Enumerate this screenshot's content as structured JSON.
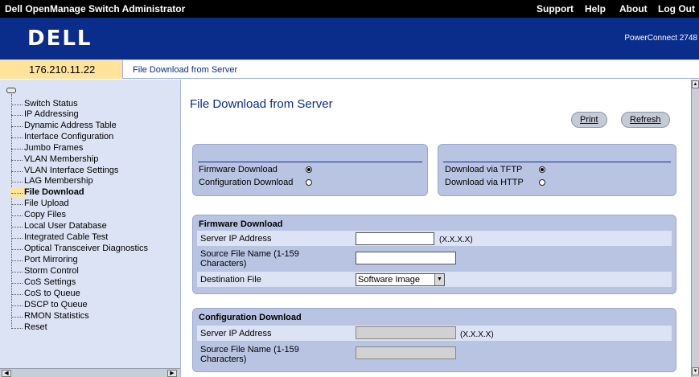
{
  "topbar": {
    "app_title": "Dell OpenManage Switch Administrator",
    "support": "Support",
    "help": "Help",
    "about": "About",
    "logout": "Log Out"
  },
  "banner": {
    "logo": "DELL",
    "product": "PowerConnect 2748"
  },
  "strip": {
    "ip": "176.210.11.22",
    "breadcrumb": "File Download from Server"
  },
  "tree": {
    "items": [
      "Switch Status",
      "IP Addressing",
      "Dynamic Address Table",
      "Interface Configuration",
      "Jumbo Frames",
      "VLAN Membership",
      "VLAN Interface Settings",
      "LAG Membership",
      "File Download",
      "File Upload",
      "Copy Files",
      "Local User Database",
      "Integrated Cable Test",
      "Optical Transceiver Diagnostics",
      "Port Mirroring",
      "Storm Control",
      "CoS Settings",
      "CoS to Queue",
      "DSCP to Queue",
      "RMON Statistics",
      "Reset"
    ],
    "active": "File Download"
  },
  "main": {
    "title": "File Download from Server",
    "print": "Print",
    "refresh": "Refresh",
    "type_panel": {
      "firmware": "Firmware Download",
      "configuration": "Configuration Download",
      "selected": "firmware"
    },
    "via_panel": {
      "tftp": "Download via TFTP",
      "http": "Download via HTTP",
      "selected": "tftp"
    },
    "firmware_section": {
      "heading": "Firmware Download",
      "server_ip_label": "Server IP Address",
      "server_ip_value": "",
      "ip_hint": "(X.X.X.X)",
      "source_label_1": "Source File Name (1-159",
      "source_label_2": "Characters)",
      "source_value": "",
      "dest_label": "Destination File",
      "dest_value": "Software Image"
    },
    "config_section": {
      "heading": "Configuration Download",
      "server_ip_label": "Server IP Address",
      "ip_hint": "(X.X.X.X)",
      "source_label_1": "Source File Name (1-159",
      "source_label_2": "Characters)"
    }
  }
}
